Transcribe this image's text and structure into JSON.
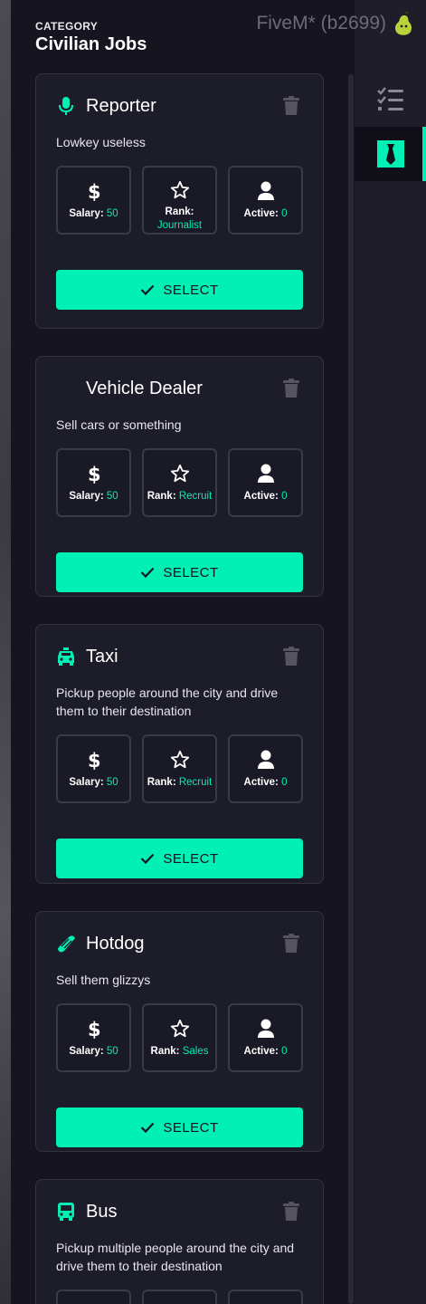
{
  "watermark": "FiveM* (b2699)",
  "category": {
    "label": "CATEGORY",
    "title": "Civilian Jobs"
  },
  "colors": {
    "accent": "#00f0b5",
    "panel": "#15141f",
    "card": "#1d1c29"
  },
  "nav": [
    {
      "icon": "checklist-icon",
      "active": false
    },
    {
      "icon": "necktie-icon",
      "active": true
    }
  ],
  "jobs": [
    {
      "icon": "microphone-icon",
      "title": "Reporter",
      "description": "Lowkey useless",
      "salary_label": "Salary:",
      "salary": "50",
      "rank_label": "Rank:",
      "rank": "Journalist",
      "active_label": "Active:",
      "active": "0",
      "button": "SELECT"
    },
    {
      "icon": "",
      "title": "Vehicle Dealer",
      "description": "Sell cars or something",
      "salary_label": "Salary:",
      "salary": "50",
      "rank_label": "Rank:",
      "rank": "Recruit",
      "active_label": "Active:",
      "active": "0",
      "button": "SELECT"
    },
    {
      "icon": "taxi-icon",
      "title": "Taxi",
      "description": "Pickup people around the city and drive them to their destination",
      "salary_label": "Salary:",
      "salary": "50",
      "rank_label": "Rank:",
      "rank": "Recruit",
      "active_label": "Active:",
      "active": "0",
      "button": "SELECT"
    },
    {
      "icon": "hotdog-icon",
      "title": "Hotdog",
      "description": "Sell them glizzys",
      "salary_label": "Salary:",
      "salary": "50",
      "rank_label": "Rank:",
      "rank": "Sales",
      "active_label": "Active:",
      "active": "0",
      "button": "SELECT"
    },
    {
      "icon": "bus-icon",
      "title": "Bus",
      "description": "Pickup multiple people around the city and drive them to their destination"
    }
  ]
}
